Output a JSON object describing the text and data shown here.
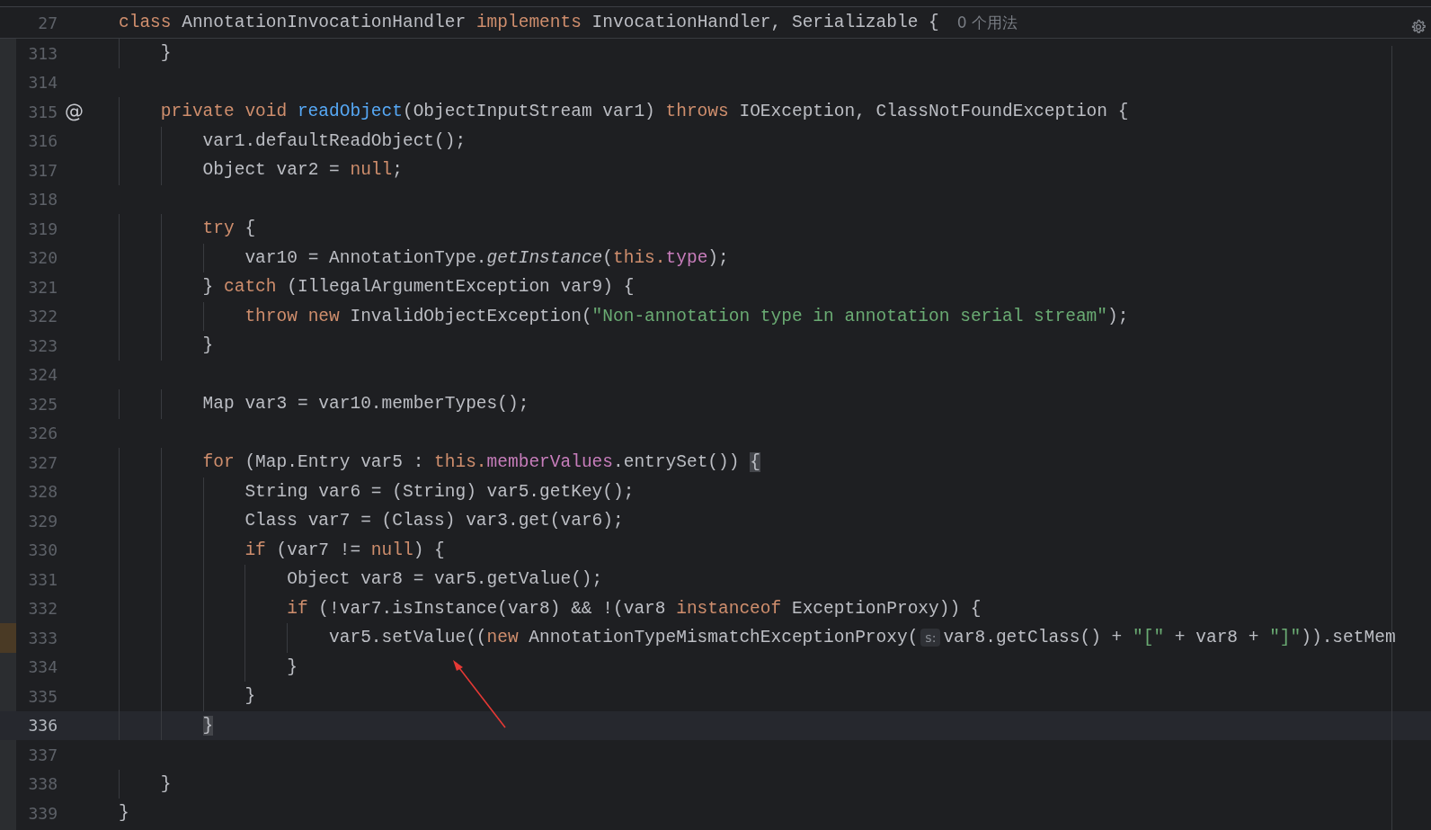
{
  "header": {
    "line": "27",
    "tokens": [
      {
        "kind": "kw",
        "text": "class"
      },
      {
        "kind": "plain",
        "text": " AnnotationInvocationHandler "
      },
      {
        "kind": "kw",
        "text": "implements"
      },
      {
        "kind": "plain",
        "text": " InvocationHandler, Serializable {"
      }
    ],
    "usages": "0 个用法"
  },
  "lines": [
    {
      "number": "313",
      "current": false,
      "changed": false,
      "tokens": [
        {
          "kind": "plain",
          "text": "    }"
        }
      ]
    },
    {
      "number": "314",
      "current": false,
      "changed": false
    },
    {
      "number": "315",
      "current": false,
      "changed": false,
      "marker": "@",
      "tokens": [
        {
          "kind": "kw",
          "text": "    private void "
        },
        {
          "kind": "decl",
          "text": "readObject"
        },
        {
          "kind": "plain",
          "text": "(ObjectInputStream var1) "
        },
        {
          "kind": "kw",
          "text": "throws"
        },
        {
          "kind": "plain",
          "text": " IOException, ClassNotFoundException {"
        }
      ]
    },
    {
      "number": "316",
      "current": false,
      "changed": false,
      "tokens": [
        {
          "kind": "plain",
          "text": "        var1.defaultReadObject();"
        }
      ]
    },
    {
      "number": "317",
      "current": false,
      "changed": false,
      "tokens": [
        {
          "kind": "plain",
          "text": "        Object var2 = "
        },
        {
          "kind": "kw",
          "text": "null"
        },
        {
          "kind": "plain",
          "text": ";"
        }
      ]
    },
    {
      "number": "318",
      "current": false,
      "changed": false
    },
    {
      "number": "319",
      "current": false,
      "changed": false,
      "tokens": [
        {
          "kind": "kw",
          "text": "        try"
        },
        {
          "kind": "plain",
          "text": " {"
        }
      ]
    },
    {
      "number": "320",
      "current": false,
      "changed": false,
      "tokens": [
        {
          "kind": "plain",
          "text": "            var10 = AnnotationType."
        },
        {
          "kind": "italic",
          "text": "getInstance"
        },
        {
          "kind": "plain",
          "text": "("
        },
        {
          "kind": "kw",
          "text": "this."
        },
        {
          "kind": "field",
          "text": "type"
        },
        {
          "kind": "plain",
          "text": ");"
        }
      ]
    },
    {
      "number": "321",
      "current": false,
      "changed": false,
      "tokens": [
        {
          "kind": "plain",
          "text": "        } "
        },
        {
          "kind": "kw",
          "text": "catch"
        },
        {
          "kind": "plain",
          "text": " (IllegalArgumentException var9) {"
        }
      ]
    },
    {
      "number": "322",
      "current": false,
      "changed": false,
      "tokens": [
        {
          "kind": "kw",
          "text": "            throw new"
        },
        {
          "kind": "plain",
          "text": " InvalidObjectException("
        },
        {
          "kind": "str",
          "text": "\"Non-annotation type in annotation serial stream\""
        },
        {
          "kind": "plain",
          "text": ");"
        }
      ]
    },
    {
      "number": "323",
      "current": false,
      "changed": false,
      "tokens": [
        {
          "kind": "plain",
          "text": "        }"
        }
      ]
    },
    {
      "number": "324",
      "current": false,
      "changed": false
    },
    {
      "number": "325",
      "current": false,
      "changed": false,
      "tokens": [
        {
          "kind": "plain",
          "text": "        Map var3 = var10.memberTypes();"
        }
      ]
    },
    {
      "number": "326",
      "current": false,
      "changed": false
    },
    {
      "number": "327",
      "current": false,
      "changed": false,
      "tokens": [
        {
          "kind": "kw",
          "text": "        for"
        },
        {
          "kind": "plain",
          "text": " (Map.Entry var5 : "
        },
        {
          "kind": "kw",
          "text": "this."
        },
        {
          "kind": "field",
          "text": "memberValues"
        },
        {
          "kind": "plain",
          "text": ".entrySet()) "
        },
        {
          "kind": "brace",
          "text": "{"
        }
      ]
    },
    {
      "number": "328",
      "current": false,
      "changed": false,
      "tokens": [
        {
          "kind": "plain",
          "text": "            String var6 = (String) var5.getKey();"
        }
      ]
    },
    {
      "number": "329",
      "current": false,
      "changed": false,
      "tokens": [
        {
          "kind": "plain",
          "text": "            Class var7 = (Class) var3.get(var6);"
        }
      ]
    },
    {
      "number": "330",
      "current": false,
      "changed": false,
      "tokens": [
        {
          "kind": "kw",
          "text": "            if"
        },
        {
          "kind": "plain",
          "text": " (var7 != "
        },
        {
          "kind": "kw",
          "text": "null"
        },
        {
          "kind": "plain",
          "text": ") {"
        }
      ]
    },
    {
      "number": "331",
      "current": false,
      "changed": false,
      "tokens": [
        {
          "kind": "plain",
          "text": "                Object var8 = var5.getValue();"
        }
      ]
    },
    {
      "number": "332",
      "current": false,
      "changed": false,
      "tokens": [
        {
          "kind": "kw",
          "text": "                if"
        },
        {
          "kind": "plain",
          "text": " (!var7.isInstance(var8) && !(var8 "
        },
        {
          "kind": "kw",
          "text": "instanceof"
        },
        {
          "kind": "plain",
          "text": " ExceptionProxy)) {"
        }
      ]
    },
    {
      "number": "333",
      "current": false,
      "changed": true,
      "tokens": [
        {
          "kind": "plain",
          "text": "                    var5.setValue(("
        },
        {
          "kind": "kw",
          "text": "new"
        },
        {
          "kind": "plain",
          "text": " AnnotationTypeMismatchExceptionProxy("
        },
        {
          "kind": "hint",
          "text": "s:"
        },
        {
          "kind": "plain",
          "text": "var8.getClass() + "
        },
        {
          "kind": "str",
          "text": "\"[\""
        },
        {
          "kind": "plain",
          "text": " + var8 + "
        },
        {
          "kind": "str",
          "text": "\"]\""
        },
        {
          "kind": "plain",
          "text": ")).setMem"
        }
      ]
    },
    {
      "number": "334",
      "current": false,
      "changed": false,
      "tokens": [
        {
          "kind": "plain",
          "text": "                }"
        }
      ]
    },
    {
      "number": "335",
      "current": false,
      "changed": false,
      "tokens": [
        {
          "kind": "plain",
          "text": "            }"
        }
      ]
    },
    {
      "number": "336",
      "current": true,
      "changed": false,
      "tokens": [
        {
          "kind": "brace",
          "text": "        }"
        }
      ]
    },
    {
      "number": "337",
      "current": false,
      "changed": false
    },
    {
      "number": "338",
      "current": false,
      "changed": false,
      "tokens": [
        {
          "kind": "plain",
          "text": "    }"
        }
      ]
    },
    {
      "number": "339",
      "current": false,
      "changed": false,
      "tokens": [
        {
          "kind": "plain",
          "text": "}"
        }
      ]
    }
  ]
}
